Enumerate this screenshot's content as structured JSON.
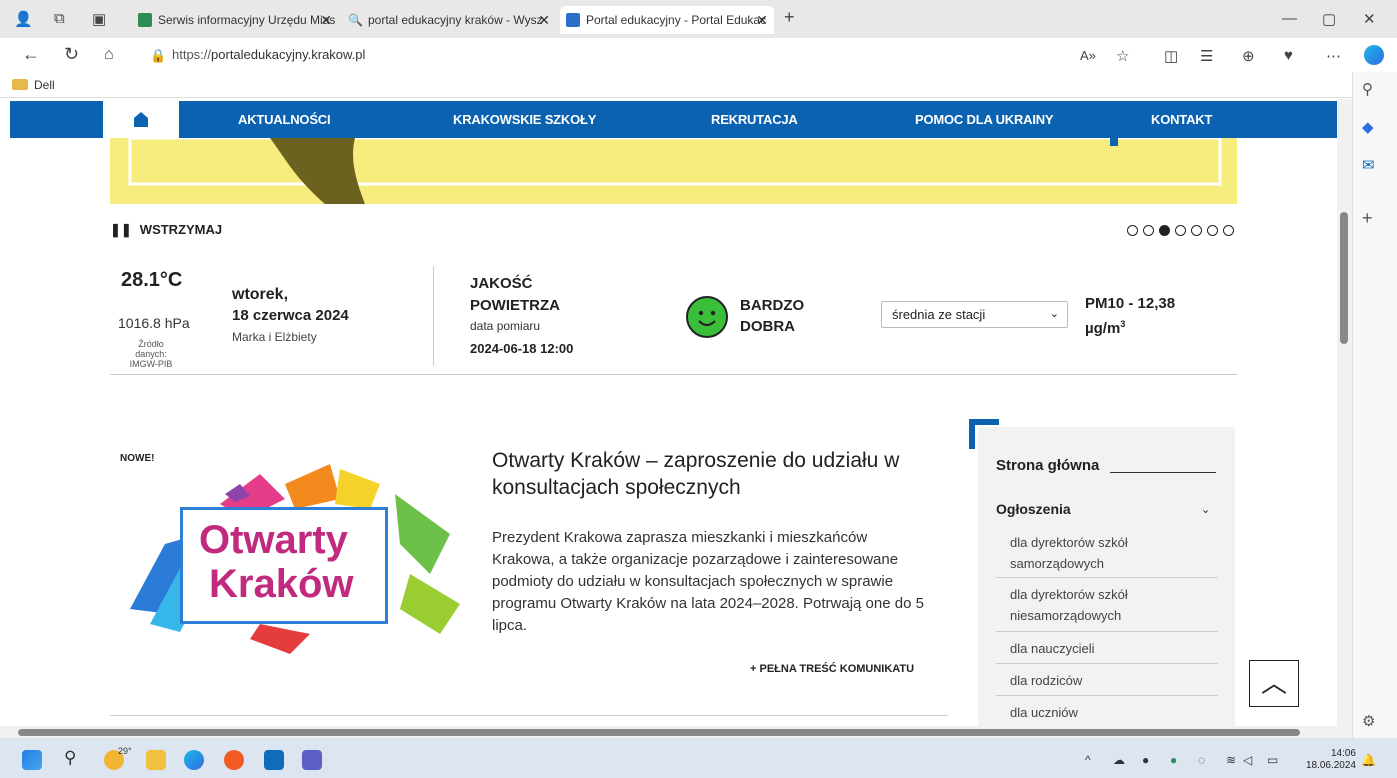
{
  "browser": {
    "tabs": [
      {
        "label": "Serwis informacyjny Urzędu Mias",
        "active": false
      },
      {
        "label": "portal edukacyjny kraków - Wysz",
        "active": false
      },
      {
        "label": "Portal edukacyjny - Portal Edukac",
        "active": true
      }
    ],
    "new_tab": "+",
    "url_prefix": "https://",
    "url_host": "portaledukacyjny.krakow.pl",
    "bookmark_folder": "Dell",
    "window_controls": {
      "minimize": "—",
      "restore": "▢",
      "close": "✕"
    }
  },
  "nav": {
    "items": [
      "AKTUALNOŚCI",
      "KRAKOWSKIE SZKOŁY",
      "REKRUTACJA",
      "POMOC DLA UKRAINY",
      "KONTAKT"
    ]
  },
  "slider": {
    "pause_label": "WSTRZYMAJ",
    "slides": 7,
    "active_slide": 3
  },
  "weather": {
    "temperature": "28.1°C",
    "pressure": "1016.8 hPa",
    "source": "Źródło danych: IMGW-PIB",
    "day": "wtorek,",
    "date": "18 czerwca 2024",
    "names": "Marka i Elżbiety"
  },
  "air_quality": {
    "title": "JAKOŚĆ POWIETRZA",
    "label": "data pomiaru",
    "date": "2024-06-18 12:00",
    "rating": "BARDZO DOBRA",
    "station_select": "średnia ze stacji",
    "pm_value": "PM10 - 12,38",
    "pm_unit": "µg/m",
    "pm_unit_sup": "3"
  },
  "news": {
    "badge": "NOWE!",
    "logo_line1": "Otwarty",
    "logo_line2": "Kraków",
    "title": "Otwarty Kraków – zaproszenie do udziału w konsultacjach społecznych",
    "body": "Prezydent Krakowa zaprasza mieszkanki i mieszkańców Krakowa, a także organizacje pozarządowe i zainteresowane podmioty do udziału w konsultacjach społecznych w sprawie programu Otwarty Kraków na lata 2024–2028. Potrwają one do 5 lipca.",
    "more": "+ PEŁNA TREŚĆ KOMUNIKATU"
  },
  "sidebar": {
    "title": "Strona główna",
    "section": "Ogłoszenia",
    "items": [
      "dla dyrektorów szkół samorządowych",
      "dla dyrektorów szkół niesamorządowych",
      "dla nauczycieli",
      "dla rodziców",
      "dla uczniów"
    ]
  },
  "taskbar": {
    "weather_temp": "29°",
    "time": "14:06",
    "date": "18.06.2024"
  },
  "colors": {
    "brand_blue": "#0b62b0",
    "banner_yellow": "#f7ec7e",
    "smiley_green": "#3bbf3b",
    "logo_magenta": "#c12a7e"
  }
}
